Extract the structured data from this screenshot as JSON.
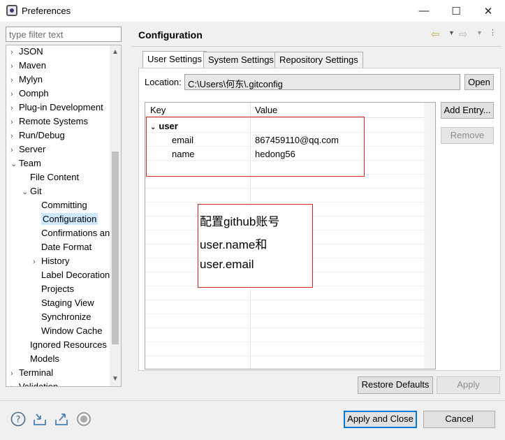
{
  "window": {
    "title": "Preferences",
    "minimize_icon": "—",
    "maximize_icon": "☐",
    "close_icon": "✕"
  },
  "filter": {
    "placeholder": "type filter text"
  },
  "tree": {
    "items": [
      {
        "label": "JSON",
        "level": 0,
        "expander": "›"
      },
      {
        "label": "Maven",
        "level": 0,
        "expander": "›"
      },
      {
        "label": "Mylyn",
        "level": 0,
        "expander": "›"
      },
      {
        "label": "Oomph",
        "level": 0,
        "expander": "›"
      },
      {
        "label": "Plug-in Development",
        "level": 0,
        "expander": "›"
      },
      {
        "label": "Remote Systems",
        "level": 0,
        "expander": "›"
      },
      {
        "label": "Run/Debug",
        "level": 0,
        "expander": "›"
      },
      {
        "label": "Server",
        "level": 0,
        "expander": "›"
      },
      {
        "label": "Team",
        "level": 0,
        "expander": "⌄"
      },
      {
        "label": "File Content",
        "level": 1,
        "expander": ""
      },
      {
        "label": "Git",
        "level": 1,
        "expander": "⌄"
      },
      {
        "label": "Committing",
        "level": 2,
        "expander": ""
      },
      {
        "label": "Configuration",
        "level": 2,
        "expander": "",
        "selected": true
      },
      {
        "label": "Confirmations and Warnings",
        "level": 2,
        "expander": ""
      },
      {
        "label": "Date Format",
        "level": 2,
        "expander": ""
      },
      {
        "label": "History",
        "level": 2,
        "expander": "›"
      },
      {
        "label": "Label Decorations",
        "level": 2,
        "expander": ""
      },
      {
        "label": "Projects",
        "level": 2,
        "expander": ""
      },
      {
        "label": "Staging View",
        "level": 2,
        "expander": ""
      },
      {
        "label": "Synchronize",
        "level": 2,
        "expander": ""
      },
      {
        "label": "Window Cache",
        "level": 2,
        "expander": ""
      },
      {
        "label": "Ignored Resources",
        "level": 1,
        "expander": ""
      },
      {
        "label": "Models",
        "level": 1,
        "expander": ""
      },
      {
        "label": "Terminal",
        "level": 0,
        "expander": "›"
      },
      {
        "label": "Validation",
        "level": 0,
        "expander": "›"
      }
    ]
  },
  "page": {
    "title": "Configuration"
  },
  "tabs": [
    {
      "label": "User Settings"
    },
    {
      "label": "System Settings"
    },
    {
      "label": "Repository Settings"
    }
  ],
  "location": {
    "label": "Location:",
    "value": "C:\\Users\\何东\\.gitconfig",
    "open_label": "Open"
  },
  "table": {
    "headers": [
      "Key",
      "Value"
    ],
    "section": "user",
    "rows": [
      {
        "key": "email",
        "value": "867459110@qq.com"
      },
      {
        "key": "name",
        "value": "hedong56"
      }
    ]
  },
  "side_buttons": {
    "add_entry": "Add Entry...",
    "remove": "Remove"
  },
  "annotation": {
    "lines": [
      "配置github账号",
      "user.name和",
      "user.email"
    ]
  },
  "footer": {
    "restore_defaults": "Restore Defaults",
    "apply": "Apply",
    "apply_and_close": "Apply and Close",
    "cancel": "Cancel"
  },
  "colors": {
    "selection": "#cde8ff",
    "annotation_border": "#dd2222",
    "primary_border": "#0078d7"
  }
}
